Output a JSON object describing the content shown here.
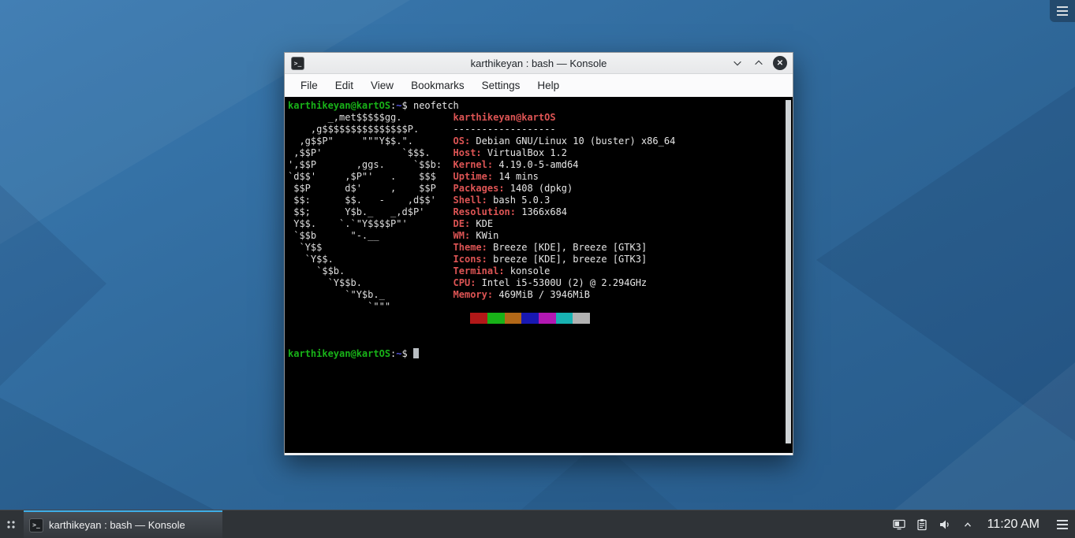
{
  "colors": {
    "accent": "#3daee9",
    "term_green": "#18b218",
    "term_blue": "#5252e0",
    "term_red": "#dd5454",
    "term_fg": "#e6e6e6",
    "term_art": "#dddddd"
  },
  "window": {
    "title": "karthikeyan : bash — Konsole",
    "menu_items": [
      "File",
      "Edit",
      "View",
      "Bookmarks",
      "Settings",
      "Help"
    ]
  },
  "icons": {
    "konsole_glyph": ">_",
    "close_glyph": "✕"
  },
  "terminal": {
    "prompt": {
      "user": "karthikeyan@kartOS",
      "colon": ":",
      "path": "~",
      "dollar": "$"
    },
    "command": "neofetch",
    "neofetch": {
      "ascii_art": [
        "       _,met$$$$$gg.",
        "    ,g$$$$$$$$$$$$$$$P.",
        "  ,g$$P\"     \"\"\"Y$$.\".",
        " ,$$P'              `$$$.",
        "',$$P       ,ggs.     `$$b:",
        "`d$$'     ,$P\"'   .    $$$",
        " $$P      d$'     ,    $$P",
        " $$:      $$.   -    ,d$$'",
        " $$;      Y$b._   _,d$P'",
        " Y$$.    `.`\"Y$$$$P\"'",
        " `$$b      \"-.__",
        "  `Y$$",
        "   `Y$$.",
        "     `$$b.",
        "       `Y$$b.",
        "          `\"Y$b._",
        "              `\"\"\""
      ],
      "title": "karthikeyan@kartOS",
      "separator": "------------------",
      "info": [
        {
          "label": "OS",
          "value": "Debian GNU/Linux 10 (buster) x86_64"
        },
        {
          "label": "Host",
          "value": "VirtualBox 1.2"
        },
        {
          "label": "Kernel",
          "value": "4.19.0-5-amd64"
        },
        {
          "label": "Uptime",
          "value": "14 mins"
        },
        {
          "label": "Packages",
          "value": "1408 (dpkg)"
        },
        {
          "label": "Shell",
          "value": "bash 5.0.3"
        },
        {
          "label": "Resolution",
          "value": "1366x684"
        },
        {
          "label": "DE",
          "value": "KDE"
        },
        {
          "label": "WM",
          "value": "KWin"
        },
        {
          "label": "Theme",
          "value": "Breeze [KDE], Breeze [GTK3]"
        },
        {
          "label": "Icons",
          "value": "breeze [KDE], breeze [GTK3]"
        },
        {
          "label": "Terminal",
          "value": "konsole"
        },
        {
          "label": "CPU",
          "value": "Intel i5-5300U (2) @ 2.294GHz"
        },
        {
          "label": "Memory",
          "value": "469MiB / 3946MiB"
        }
      ],
      "palette": [
        "#000000",
        "#b21818",
        "#18b218",
        "#b26818",
        "#1818b2",
        "#b218b2",
        "#18b2b2",
        "#b2b2b2"
      ]
    }
  },
  "taskbar": {
    "task": {
      "label": "karthikeyan : bash — Konsole"
    },
    "clock": "11:20 AM"
  }
}
